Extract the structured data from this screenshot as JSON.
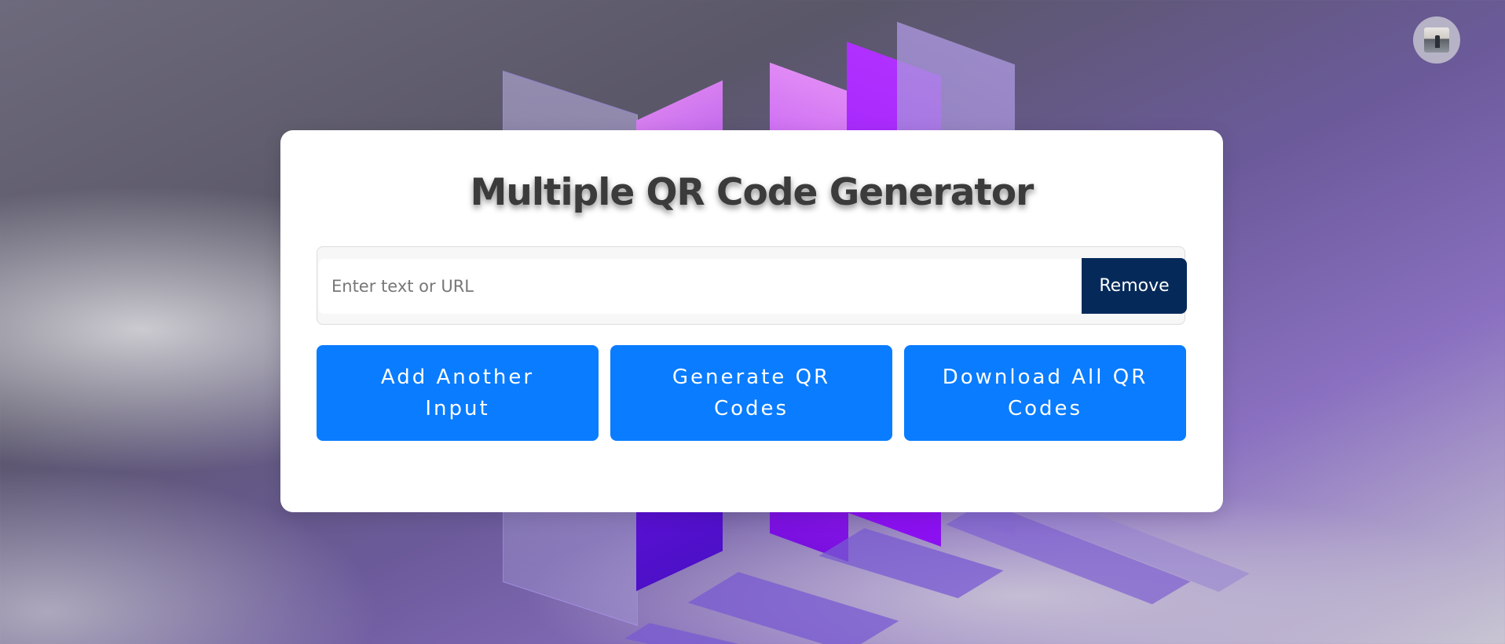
{
  "app": {
    "title": "Multiple QR Code Generator"
  },
  "inputs": [
    {
      "value": "",
      "placeholder": "Enter text or URL",
      "remove_label": "Remove"
    }
  ],
  "actions": {
    "add_label": "Add Another Input",
    "generate_label": "Generate QR Codes",
    "download_label": "Download All QR Codes"
  },
  "user": {
    "avatar_icon": "user-photo-icon"
  },
  "colors": {
    "primary_button": "#0a7cff",
    "remove_button": "#052a5a",
    "card": "#ffffff",
    "title_text": "#3b3b3b"
  }
}
